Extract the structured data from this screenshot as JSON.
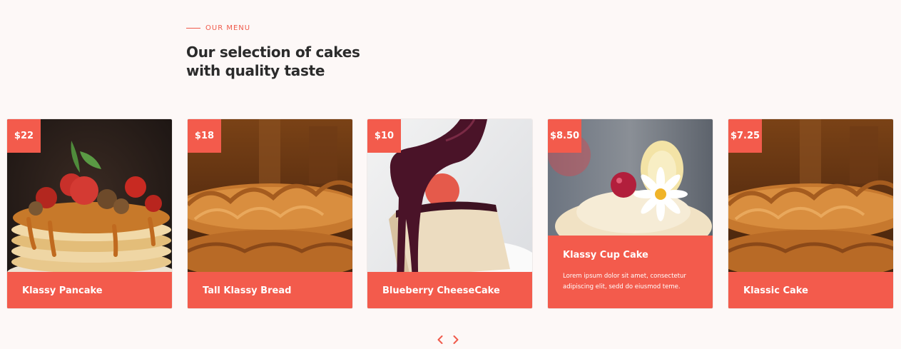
{
  "section": {
    "eyebrow": "OUR MENU",
    "title_line1": "Our selection of cakes",
    "title_line2": "with quality taste"
  },
  "cards": [
    {
      "price": "$22",
      "name": "Klassy Pancake"
    },
    {
      "price": "$18",
      "name": "Tall Klassy Bread"
    },
    {
      "price": "$10",
      "name": "Blueberry CheeseCake"
    },
    {
      "price": "$8.50",
      "name": "Klassy Cup Cake",
      "description": "Lorem ipsum dolor sit amet, consectetur adipiscing elit, sedd do eiusmod teme."
    },
    {
      "price": "$7.25",
      "name": "Klassic Cake"
    }
  ],
  "colors": {
    "accent": "#f35b4c",
    "heading": "#2b2b2b",
    "background": "#fdf8f7"
  },
  "icons": {
    "prev": "chevron-left-icon",
    "next": "chevron-right-icon"
  }
}
